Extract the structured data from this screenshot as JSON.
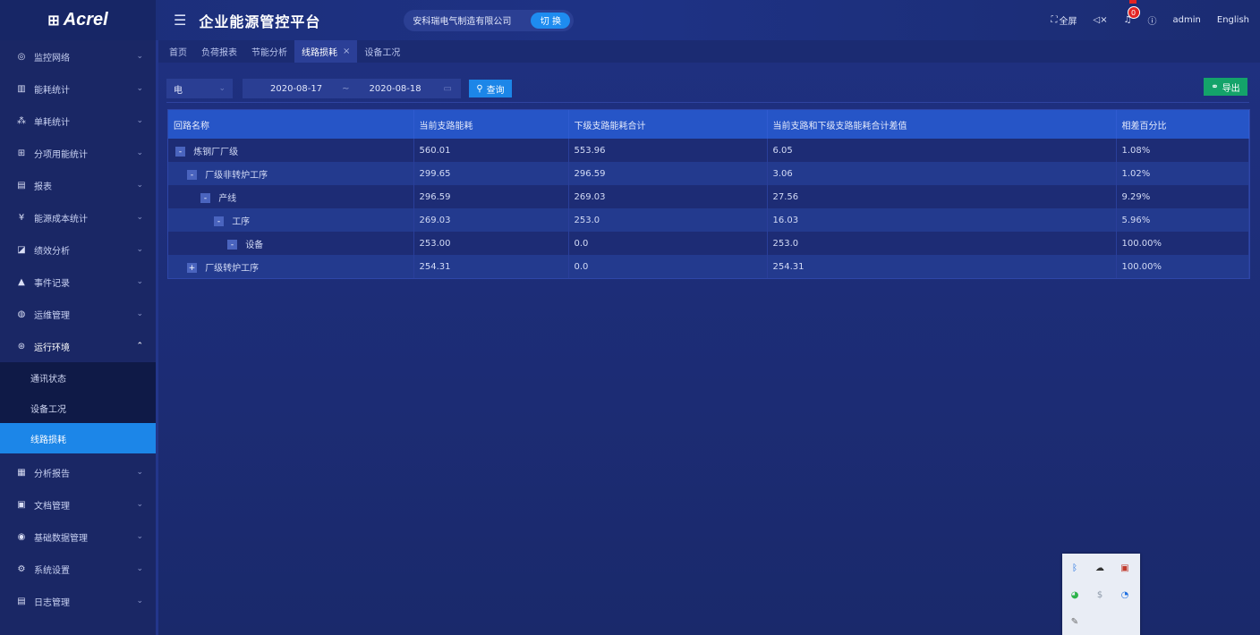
{
  "header": {
    "logo_text": "Acrel",
    "app_title": "企业能源管控平台",
    "company": "安科瑞电气制造有限公司",
    "switch_label": "切 换",
    "fullscreen_label": "全屏",
    "notification_count": "0",
    "user": "admin",
    "language": "English"
  },
  "sidebar": {
    "items": [
      {
        "label": "监控网络",
        "icon": "monitor-icon"
      },
      {
        "label": "能耗统计",
        "icon": "bar-chart-icon"
      },
      {
        "label": "单耗统计",
        "icon": "nodes-icon"
      },
      {
        "label": "分项用能统计",
        "icon": "grid-icon"
      },
      {
        "label": "报表",
        "icon": "report-icon"
      },
      {
        "label": "能源成本统计",
        "icon": "cost-icon"
      },
      {
        "label": "绩效分析",
        "icon": "analysis-icon"
      },
      {
        "label": "事件记录",
        "icon": "warning-icon"
      },
      {
        "label": "运维管理",
        "icon": "maintenance-icon"
      },
      {
        "label": "运行环境",
        "icon": "environment-icon"
      },
      {
        "label": "分析报告",
        "icon": "analysis-report-icon"
      },
      {
        "label": "文档管理",
        "icon": "document-icon"
      },
      {
        "label": "基础数据管理",
        "icon": "database-icon"
      },
      {
        "label": "系统设置",
        "icon": "settings-icon"
      },
      {
        "label": "日志管理",
        "icon": "log-icon"
      }
    ],
    "sub_items": [
      "通讯状态",
      "设备工况",
      "线路损耗"
    ]
  },
  "tabs": [
    {
      "label": "首页"
    },
    {
      "label": "负荷报表"
    },
    {
      "label": "节能分析"
    },
    {
      "label": "线路损耗",
      "active": true
    },
    {
      "label": "设备工况"
    }
  ],
  "filters": {
    "energy_type": "电",
    "start_date": "2020-08-17",
    "range_sep": "~",
    "end_date": "2020-08-18",
    "query_label": "查询",
    "export_label": "导出"
  },
  "table": {
    "headers": [
      "回路名称",
      "当前支路能耗",
      "下级支路能耗合计",
      "当前支路和下级支路能耗合计差值",
      "相差百分比"
    ],
    "rows": [
      {
        "name": "炼钢厂厂级",
        "level": 0,
        "toggle": "-",
        "current": "560.01",
        "sub_total": "553.96",
        "diff": "6.05",
        "percent": "1.08%"
      },
      {
        "name": "厂级非转炉工序",
        "level": 1,
        "toggle": "-",
        "current": "299.65",
        "sub_total": "296.59",
        "diff": "3.06",
        "percent": "1.02%"
      },
      {
        "name": "产线",
        "level": 2,
        "toggle": "-",
        "current": "296.59",
        "sub_total": "269.03",
        "diff": "27.56",
        "percent": "9.29%"
      },
      {
        "name": "工序",
        "level": 3,
        "toggle": "-",
        "current": "269.03",
        "sub_total": "253.0",
        "diff": "16.03",
        "percent": "5.96%"
      },
      {
        "name": "设备",
        "level": 4,
        "toggle": "-",
        "current": "253.00",
        "sub_total": "0.0",
        "diff": "253.0",
        "percent": "100.00%"
      },
      {
        "name": "厂级转炉工序",
        "level": 1,
        "toggle": "+",
        "current": "254.31",
        "sub_total": "0.0",
        "diff": "254.31",
        "percent": "100.00%"
      }
    ]
  },
  "colors": {
    "accent": "#1c86e8",
    "export": "#14a36a",
    "header_row": "#2655c7",
    "badge": "#e32424"
  }
}
